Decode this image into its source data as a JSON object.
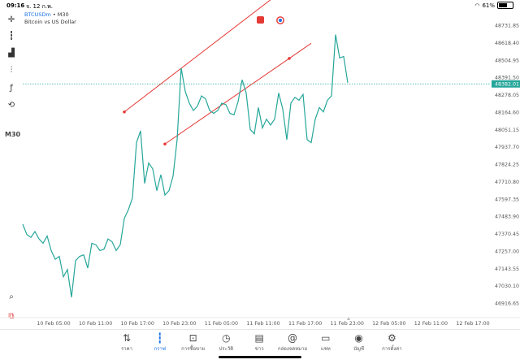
{
  "status_bar": {
    "time": "09:16",
    "date": "จ. 12 ก.พ.",
    "battery": "61%",
    "battery_level": 0.61
  },
  "symbol": {
    "ticker": "BTCUSDm",
    "timeframe": "M30",
    "description": "Bitcoin vs US Dollar"
  },
  "toolbar": {
    "timeframe_label": "M30"
  },
  "price_axis": {
    "labels": [
      "48731.85",
      "48618.40",
      "48504.95",
      "48391.50",
      "48278.05",
      "48164.60",
      "48051.15",
      "47937.70",
      "47824.25",
      "47710.80",
      "47597.35",
      "47483.90",
      "47370.45",
      "47257.00",
      "47143.55",
      "47030.10",
      "46916.65"
    ],
    "current_price": "48382.01"
  },
  "time_axis": {
    "labels": [
      "10 Feb 05:00",
      "10 Feb 11:00",
      "10 Feb 17:00",
      "10 Feb 23:00",
      "11 Feb 05:00",
      "11 Feb 11:00",
      "11 Feb 17:00",
      "11 Feb 23:00",
      "12 Feb 05:00",
      "12 Feb 11:00",
      "12 Feb 17:00"
    ]
  },
  "chart_data": {
    "type": "line",
    "symbol": "BTCUSDm",
    "timeframe": "M30",
    "ylim": [
      46880,
      48790
    ],
    "x": [
      0,
      1,
      2,
      3,
      4,
      5,
      6,
      7,
      8,
      9,
      10,
      11,
      12,
      13,
      14,
      15,
      16,
      17,
      18,
      19,
      20,
      21,
      22,
      23,
      24,
      25,
      26,
      27,
      28,
      29,
      30,
      31,
      32,
      33,
      34,
      35,
      36,
      37,
      38,
      39,
      40,
      41,
      42,
      43,
      44,
      45,
      46,
      47,
      48,
      49,
      50,
      51,
      52,
      53,
      54,
      55,
      56,
      57,
      58,
      59,
      60,
      61,
      62,
      63,
      64,
      65,
      66,
      67,
      68,
      69,
      70,
      71,
      72,
      73,
      74,
      75,
      76,
      77,
      78,
      79,
      80
    ],
    "values": [
      47420,
      47350,
      47330,
      47370,
      47320,
      47290,
      47340,
      47240,
      47180,
      47200,
      47060,
      47110,
      46920,
      47170,
      47200,
      47210,
      47120,
      47290,
      47280,
      47240,
      47250,
      47320,
      47300,
      47240,
      47280,
      47460,
      47520,
      47600,
      47980,
      48060,
      47700,
      47840,
      47800,
      47650,
      47760,
      47620,
      47650,
      47750,
      48000,
      48490,
      48330,
      48250,
      48200,
      48230,
      48300,
      48280,
      48200,
      48180,
      48200,
      48250,
      48240,
      48180,
      48170,
      48260,
      48410,
      48320,
      48070,
      48040,
      48220,
      48080,
      48140,
      48100,
      48140,
      48320,
      48210,
      48000,
      48250,
      48290,
      48270,
      48310,
      48000,
      47980,
      48140,
      48220,
      48190,
      48270,
      48300,
      48720,
      48560,
      48570,
      48390
    ],
    "current_price": 48382.01,
    "trend_lines": [
      {
        "color": "#e53935",
        "points": [
          [
            25,
            48190
          ],
          [
            62,
            48980
          ]
        ]
      },
      {
        "color": "#e53935",
        "points": [
          [
            35,
            47970
          ],
          [
            71,
            48660
          ]
        ]
      }
    ],
    "xlabel": "",
    "ylabel": ""
  },
  "bottom_nav": [
    {
      "label": "ราคา",
      "icon": "quotes-icon",
      "active": false
    },
    {
      "label": "กราฟ",
      "icon": "chart-icon",
      "active": true
    },
    {
      "label": "การซื้อขาย",
      "icon": "trade-icon",
      "active": false
    },
    {
      "label": "ประวัติ",
      "icon": "history-icon",
      "active": false
    },
    {
      "label": "ข่าว",
      "icon": "news-icon",
      "active": false
    },
    {
      "label": "กล่องจดหมาย",
      "icon": "mailbox-icon",
      "active": false
    },
    {
      "label": "แชท",
      "icon": "chat-icon",
      "active": false
    },
    {
      "label": "บัญชี",
      "icon": "account-icon",
      "active": false
    },
    {
      "label": "การตั้งค่า",
      "icon": "settings-icon",
      "active": false
    }
  ],
  "colors": {
    "line": "#26a69a",
    "trend": "#e53935",
    "accent": "#1a73e8",
    "current_price_line": "#26a69a"
  }
}
